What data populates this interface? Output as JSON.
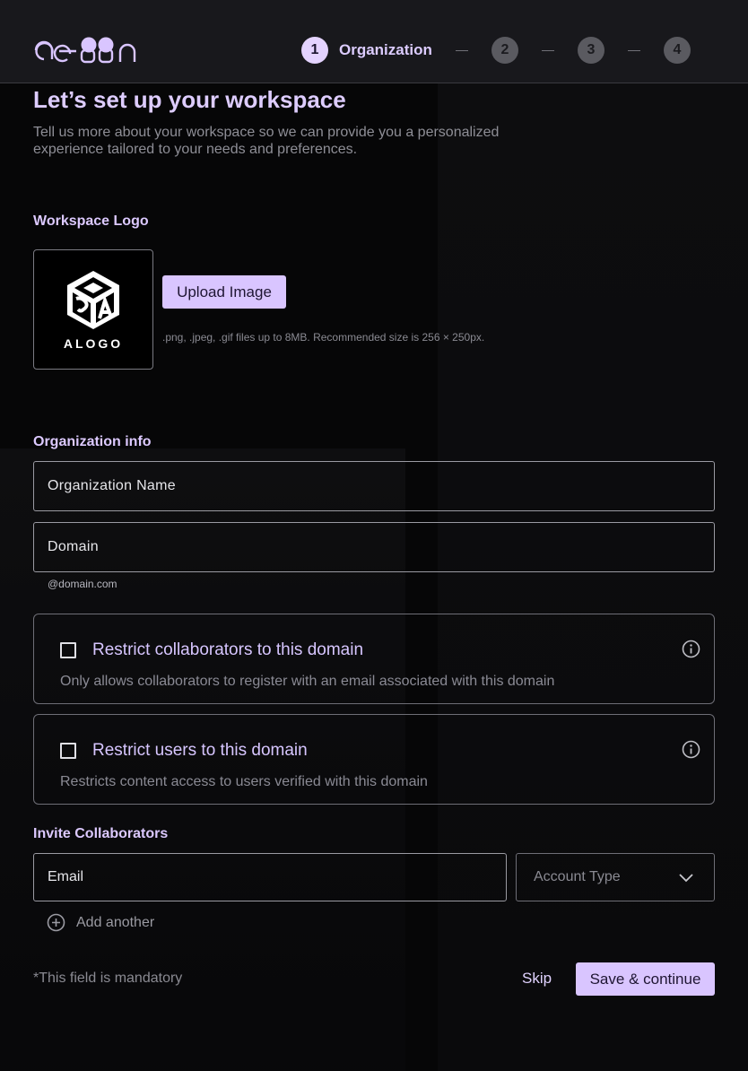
{
  "header": {
    "logo_text": "aeon",
    "steps": [
      {
        "number": "1",
        "label": "Organization",
        "active": true
      },
      {
        "number": "2",
        "label": "",
        "active": false
      },
      {
        "number": "3",
        "label": "",
        "active": false
      },
      {
        "number": "4",
        "label": "",
        "active": false
      }
    ]
  },
  "page": {
    "title": "Let’s set up your workspace",
    "subtitle": "Tell us more about your workspace so we can provide you a personalized experience tailored to your needs and preferences."
  },
  "workspace_logo": {
    "section_label": "Workspace Logo",
    "logo_text": "ALOGO",
    "upload_label": "Upload Image",
    "hint": ".png, .jpeg, .gif files up to 8MB. Recommended size is 256 × 250px."
  },
  "org_info": {
    "section_label": "Organization info",
    "org_name_placeholder": "Organization Name",
    "domain_placeholder": "Domain",
    "domain_hint": "@domain.com"
  },
  "options": [
    {
      "title": "Restrict collaborators to this domain",
      "description": "Only allows collaborators to register with an email associated with this domain",
      "checked": false
    },
    {
      "title": "Restrict users to this domain",
      "description": "Restricts content access to users verified with this domain",
      "checked": false
    }
  ],
  "invite": {
    "section_label": "Invite Collaborators",
    "email_placeholder": "Email",
    "account_type_placeholder": "Account Type",
    "add_another_label": "Add another"
  },
  "footer": {
    "mandatory_note": "*This field is mandatory",
    "skip_label": "Skip",
    "save_label": "Save & continue"
  },
  "colors": {
    "accent": "#d9c5ff",
    "heading": "#ddccff",
    "background": "#060607",
    "header_bg": "#18181c"
  },
  "icons": {
    "logo_mark": "aeon-logo-icon",
    "info": "info-icon",
    "chevron": "chevron-down-icon",
    "add": "plus-circle-icon",
    "alogo": "cube-logo-icon"
  }
}
